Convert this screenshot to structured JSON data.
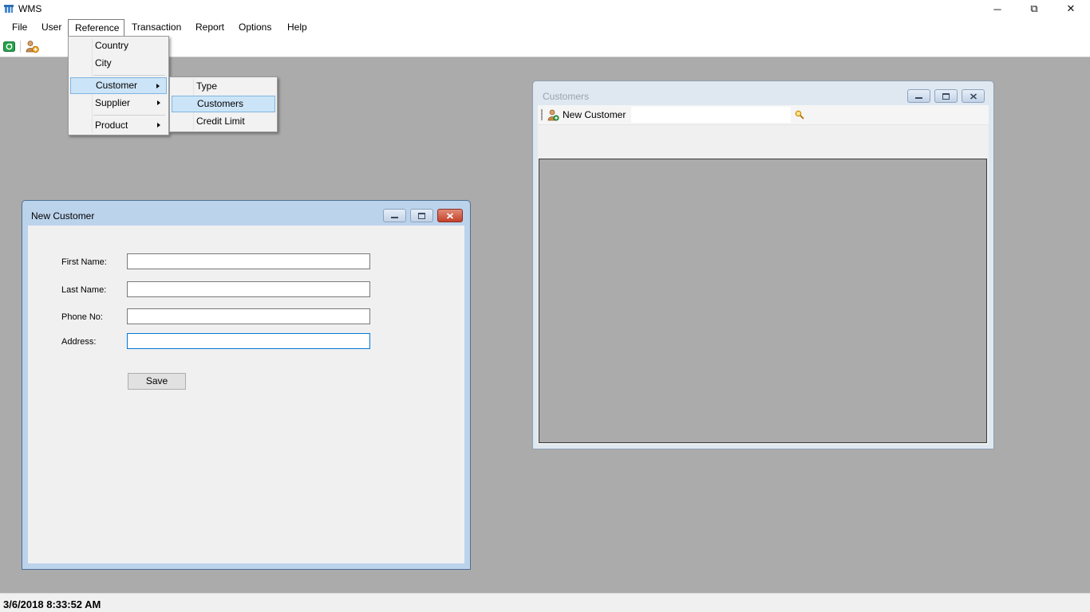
{
  "app": {
    "title": "WMS",
    "window_controls": {
      "minimize": "─",
      "restore": "⧉",
      "close": "✕"
    }
  },
  "menubar": {
    "items": [
      "File",
      "User",
      "Reference",
      "Transaction",
      "Report",
      "Options",
      "Help"
    ],
    "open_item": "Reference"
  },
  "reference_menu": {
    "items": [
      "Country",
      "City",
      "Customer",
      "Supplier",
      "Product"
    ],
    "highlighted": "Customer"
  },
  "customer_submenu": {
    "items": [
      "Type",
      "Customers",
      "Credit Limit"
    ],
    "highlighted": "Customers"
  },
  "new_customer_window": {
    "title": "New Customer",
    "fields": {
      "first_name": {
        "label": "First Name:",
        "value": ""
      },
      "last_name": {
        "label": "Last Name:",
        "value": ""
      },
      "phone_no": {
        "label": "Phone No:",
        "value": ""
      },
      "address": {
        "label": "Address:",
        "value": ""
      }
    },
    "save_label": "Save"
  },
  "customers_window": {
    "title": "Customers",
    "new_customer_label": "New Customer",
    "search_value": ""
  },
  "statusbar": {
    "datetime": "3/6/2018 8:33:52 AM"
  },
  "colors": {
    "mdi_background": "#ababab",
    "menu_highlight": "#cce4f7",
    "focus_border": "#0078d7",
    "window_frame_active": "#bcd3ec"
  }
}
